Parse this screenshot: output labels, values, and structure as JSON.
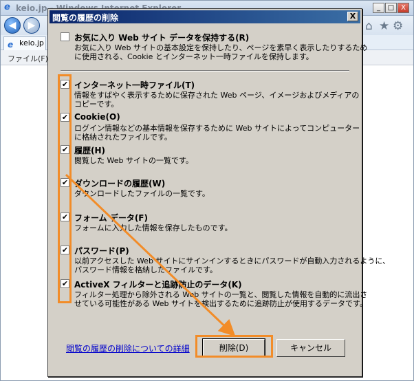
{
  "browser": {
    "title": "keio.jp - Windows Internet Explorer",
    "tab_label": "keio.jp",
    "menu_file": "ファイル(F)",
    "logo_letter": "e",
    "win_minimize": "_",
    "win_maximize": "□",
    "win_close": "X",
    "nav_back": "◀",
    "nav_forward": "▶",
    "icon_home": "⌂",
    "icon_favorites": "★",
    "icon_tools": "⚙"
  },
  "dialog": {
    "title": "閲覧の履歴の削除",
    "close": "X",
    "options": [
      {
        "label": "お気に入り Web サイト データを保持する(R)",
        "checked": false,
        "desc": [
          "お気に入り Web サイトの基本設定を保持したり、ページを素早く表示したりするため",
          "に使用される、Cookie とインターネット一時ファイルを保持します。"
        ]
      },
      {
        "label": "インターネット一時ファイル(T)",
        "checked": true,
        "desc": [
          "情報をすばやく表示するために保存された Web ページ、イメージおよびメディアの",
          "コピーです。"
        ]
      },
      {
        "label": "Cookie(O)",
        "checked": true,
        "desc": [
          "ログイン情報などの基本情報を保存するために Web サイトによってコンピューター",
          "に格納されたファイルです。"
        ]
      },
      {
        "label": "履歴(H)",
        "checked": true,
        "desc": [
          "閲覧した Web サイトの一覧です。"
        ]
      },
      {
        "label": "ダウンロードの履歴(W)",
        "checked": true,
        "desc": [
          "ダウンロードしたファイルの一覧です。"
        ]
      },
      {
        "label": "フォーム データ(F)",
        "checked": true,
        "desc": [
          "フォームに入力した情報を保存したものです。"
        ]
      },
      {
        "label": "パスワード(P)",
        "checked": true,
        "desc": [
          "以前アクセスした Web サイトにサインインするときにパスワードが自動入力されるように、",
          "パスワード情報を格納したファイルです。"
        ]
      },
      {
        "label": "ActiveX フィルターと追跡防止のデータ(K)",
        "checked": true,
        "desc": [
          "フィルター処理から除外される Web サイトの一覧と、閲覧した情報を自動的に流出さ",
          "せている可能性がある Web サイトを検出するために追跡防止が使用するデータです。"
        ]
      }
    ],
    "help_link": "閲覧の履歴の削除についての詳細",
    "delete_button": "削除(D)",
    "cancel_button": "キャンセル"
  },
  "colors": {
    "annotation": "#f28c28",
    "dialog_bg": "#d4d0c8",
    "title_gradient_start": "#0a246a",
    "title_gradient_end": "#3a6ea5"
  }
}
